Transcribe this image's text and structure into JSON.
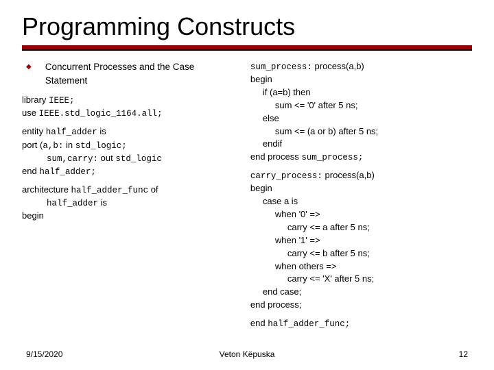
{
  "title": "Programming Constructs",
  "subtitle": "Concurrent Processes and the Case Statement",
  "left": {
    "lib1": "library",
    "lib1b": "IEEE;",
    "use1": "use",
    "use1b": "IEEE.std_logic_1164.all;",
    "ent": "entity",
    "entname": "half_adder",
    "is": "is",
    "port": "port (",
    "ab": "a,b:",
    "in": "in",
    "stdlogic": "std_logic;",
    "sumcarry": "sum,carry:",
    "out": "out",
    "stdlogic2": "std_logic",
    "end": "end",
    "endent": "half_adder;",
    "arch": "architecture",
    "archname": "half_adder_func",
    "of": "of",
    "archof": "half_adder",
    "is2": "is",
    "begin": "begin"
  },
  "right": {
    "sp": "sum_process:",
    "proc": "process(a,b)",
    "begin": "begin",
    "if": "if (a=b) then",
    "s1": "sum <= '0' after 5 ns;",
    "else": "else",
    "s2": "sum <= (a or b) after 5 ns;",
    "endif": "endif",
    "endp": "end process",
    "endpn": "sum_process;",
    "cp": "carry_process:",
    "proc2": "process(a,b)",
    "begin2": "begin",
    "case": "case a is",
    "w0": "when '0' =>",
    "c0": "carry <= a after 5 ns;",
    "w1": "when '1' =>",
    "c1": "carry <= b after 5 ns;",
    "wo": "when others  =>",
    "co": "carry <= 'X' after 5 ns;",
    "endcase": "end case;",
    "endp2": "end process;",
    "endarch": "end",
    "endarchn": "half_adder_func;"
  },
  "footer": {
    "date": "9/15/2020",
    "author": "Veton Këpuska",
    "page": "12"
  }
}
